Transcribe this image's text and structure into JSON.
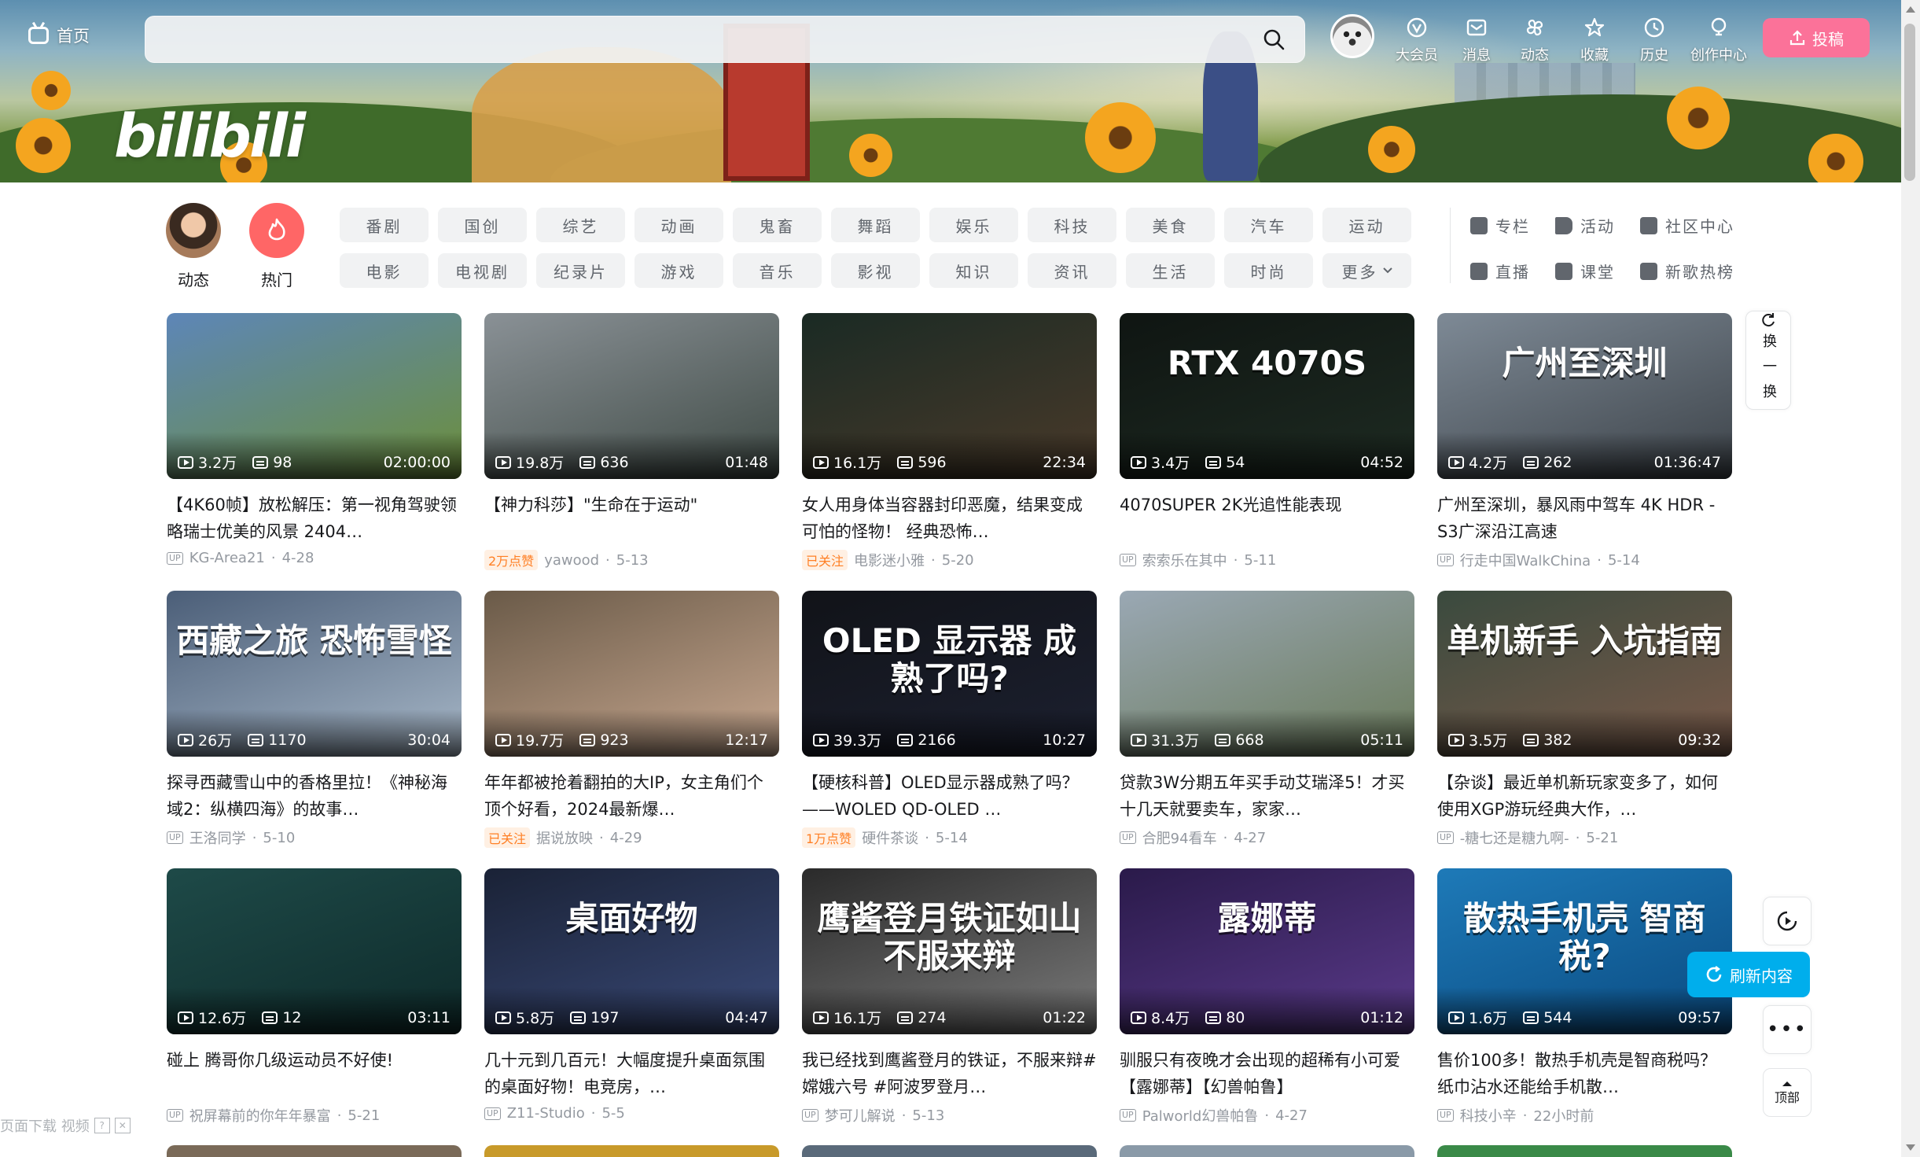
{
  "topnav": {
    "home_label": "首页",
    "search_placeholder": "",
    "items": [
      {
        "label": "大会员",
        "icon": "vip-icon"
      },
      {
        "label": "消息",
        "icon": "message-icon"
      },
      {
        "label": "动态",
        "icon": "dynamic-icon"
      },
      {
        "label": "收藏",
        "icon": "star-icon"
      },
      {
        "label": "历史",
        "icon": "clock-icon"
      },
      {
        "label": "创作中心",
        "icon": "bulb-icon"
      }
    ],
    "upload_label": "投稿"
  },
  "banner": {
    "logo_text": "bilibili"
  },
  "channels": {
    "dynamic_label": "动态",
    "hot_label": "热门",
    "row1": [
      "番剧",
      "国创",
      "综艺",
      "动画",
      "鬼畜",
      "舞蹈",
      "娱乐",
      "科技",
      "美食",
      "汽车",
      "运动"
    ],
    "row2": [
      "电影",
      "电视剧",
      "纪录片",
      "游戏",
      "音乐",
      "影视",
      "知识",
      "资讯",
      "生活",
      "时尚",
      "更多"
    ],
    "side": [
      {
        "label": "专栏",
        "icon": "column-icon"
      },
      {
        "label": "活动",
        "icon": "flag-icon"
      },
      {
        "label": "社区中心",
        "icon": "community-icon"
      },
      {
        "label": "直播",
        "icon": "live-icon"
      },
      {
        "label": "课堂",
        "icon": "class-icon"
      },
      {
        "label": "新歌热榜",
        "icon": "music-chart-icon"
      }
    ]
  },
  "videos": [
    {
      "views": "3.2万",
      "danmaku": "98",
      "duration": "02:00:00",
      "title": "【4K60帧】放松解压：第一视角驾驶领略瑞士优美的风景 2404…",
      "badge": "",
      "author": "KG-Area21",
      "date": "4-28",
      "thumb_text": "",
      "c1": "#5d86b8",
      "c2": "#6c8f3a"
    },
    {
      "views": "19.8万",
      "danmaku": "636",
      "duration": "01:48",
      "title": "【神力科莎】\"生命在于运动\"",
      "badge": "2万点赞",
      "author": "yawood",
      "date": "5-13",
      "thumb_text": "",
      "c1": "#8a9196",
      "c2": "#3f4a45"
    },
    {
      "views": "16.1万",
      "danmaku": "596",
      "duration": "22:34",
      "title": "女人用身体当容器封印恶魔，结果变成可怕的怪物！ 经典恐怖…",
      "badge": "已关注",
      "author": "电影迷小雅",
      "date": "5-20",
      "thumb_text": "",
      "c1": "#1a2a24",
      "c2": "#4a3a2a"
    },
    {
      "views": "3.4万",
      "danmaku": "54",
      "duration": "04:52",
      "title": "4070SUPER 2K光追性能表现",
      "badge": "",
      "author": "索索乐在其中",
      "date": "5-11",
      "thumb_text": "RTX 4070S",
      "c1": "#0f1512",
      "c2": "#1e2b22"
    },
    {
      "views": "4.2万",
      "danmaku": "262",
      "duration": "01:36:47",
      "title": "广州至深圳，暴风雨中驾车 4K HDR - S3广深沿江高速",
      "badge": "",
      "author": "行走中国WalkChina",
      "date": "5-14",
      "thumb_text": "广州至深圳",
      "c1": "#7e8a96",
      "c2": "#3c4248"
    },
    {
      "views": "26万",
      "danmaku": "1170",
      "duration": "30:04",
      "title": "探寻西藏雪山中的香格里拉！《神秘海域2：纵横四海》的故事…",
      "badge": "",
      "author": "王洛同学",
      "date": "5-10",
      "thumb_text": "西藏之旅 恐怖雪怪",
      "c1": "#4b5e78",
      "c2": "#a8b8c8"
    },
    {
      "views": "19.7万",
      "danmaku": "923",
      "duration": "12:17",
      "title": "年年都被抢着翻拍的大IP，女主角们个顶个好看，2024最新爆…",
      "badge": "已关注",
      "author": "据说放映",
      "date": "4-29",
      "thumb_text": "",
      "c1": "#6a5a48",
      "c2": "#c8a890"
    },
    {
      "views": "39.3万",
      "danmaku": "2166",
      "duration": "10:27",
      "title": "【硬核科普】OLED显示器成熟了吗？——WOLED QD-OLED …",
      "badge": "1万点赞",
      "author": "硬件茶谈",
      "date": "5-14",
      "thumb_text": "OLED 显示器 成熟了吗?",
      "c1": "#111318",
      "c2": "#1c2030"
    },
    {
      "views": "31.3万",
      "danmaku": "668",
      "duration": "05:11",
      "title": "贷款3W分期五年买手动艾瑞泽5！才买十几天就要卖车，家家…",
      "badge": "",
      "author": "合肥94看车",
      "date": "4-27",
      "thumb_text": "",
      "c1": "#9aa8b4",
      "c2": "#6a7a5a"
    },
    {
      "views": "3.5万",
      "danmaku": "382",
      "duration": "09:32",
      "title": "【杂谈】最近单机新玩家变多了，如何使用XGP游玩经典大作，…",
      "badge": "",
      "author": "-糖七还是糖九啊-",
      "date": "5-21",
      "thumb_text": "单机新手 入坑指南",
      "c1": "#3a4a3e",
      "c2": "#7a5a4a"
    },
    {
      "views": "12.6万",
      "danmaku": "12",
      "duration": "03:11",
      "title": "碰上 腾哥你几级运动员不好使!",
      "badge": "",
      "author": "祝屏幕前的你年年暴富",
      "date": "5-21",
      "thumb_text": "",
      "c1": "#1e4a48",
      "c2": "#0e2a2a"
    },
    {
      "views": "5.8万",
      "danmaku": "197",
      "duration": "04:47",
      "title": "几十元到几百元！大幅度提升桌面氛围的桌面好物！电竞房，…",
      "badge": "",
      "author": "Z11-Studio",
      "date": "5-5",
      "thumb_text": "桌面好物",
      "c1": "#1a2236",
      "c2": "#3a4a78"
    },
    {
      "views": "16.1万",
      "danmaku": "274",
      "duration": "01:22",
      "title": "我已经找到鹰酱登月的铁证，不服来辩#嫦娥六号 #阿波罗登月…",
      "badge": "",
      "author": "梦可儿解说",
      "date": "5-13",
      "thumb_text": "鹰酱登月铁证如山 不服来辩",
      "c1": "#2a2a2a",
      "c2": "#7a7a7a"
    },
    {
      "views": "8.4万",
      "danmaku": "80",
      "duration": "01:12",
      "title": "驯服只有夜晚才会出现的超稀有小可爱【露娜蒂】【幻兽帕鲁】",
      "badge": "",
      "author": "Palworld幻兽帕鲁",
      "date": "4-27",
      "thumb_text": "露娜蒂",
      "c1": "#2a1a4a",
      "c2": "#5a3a8a"
    },
    {
      "views": "1.6万",
      "danmaku": "544",
      "duration": "09:57",
      "title": "售价100多！散热手机壳是智商税吗？纸巾沾水还能给手机散…",
      "badge": "",
      "author": "科技小辛",
      "date": "22小时前",
      "thumb_text": "散热手机壳 智商税?",
      "c1": "#1e7ab8",
      "c2": "#0a4a80"
    }
  ],
  "right_controls": {
    "swap_label": "换一换",
    "refresh_label": "刷新内容",
    "top_label": "顶部"
  },
  "download_bar": {
    "label": "页面下载 视频"
  },
  "colors": {
    "brand_pink": "#fb7299",
    "brand_blue": "#00aeec",
    "hot_red": "#ff6666"
  }
}
